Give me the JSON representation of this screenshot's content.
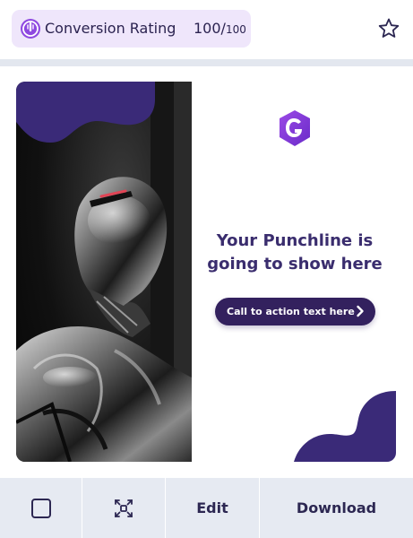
{
  "rating": {
    "label": "Conversion Rating",
    "score": "100/",
    "max": "100",
    "icon": "rating-badge-icon"
  },
  "favorite": {
    "icon": "star-outline-icon"
  },
  "ad": {
    "logo_icon": "g-hexagon-logo",
    "punchline_line1": "Your Punchline is",
    "punchline_line2": "going to show here",
    "cta_label": "Call to action text here",
    "cta_icon": "chevron-right-icon",
    "image": "chrome-robot-photo",
    "brand_color": "#3a2a78",
    "accent_color": "#8e49e0"
  },
  "footer": {
    "checkbox": "checkbox",
    "expand_icon": "expand-icon",
    "edit_label": "Edit",
    "download_label": "Download"
  }
}
